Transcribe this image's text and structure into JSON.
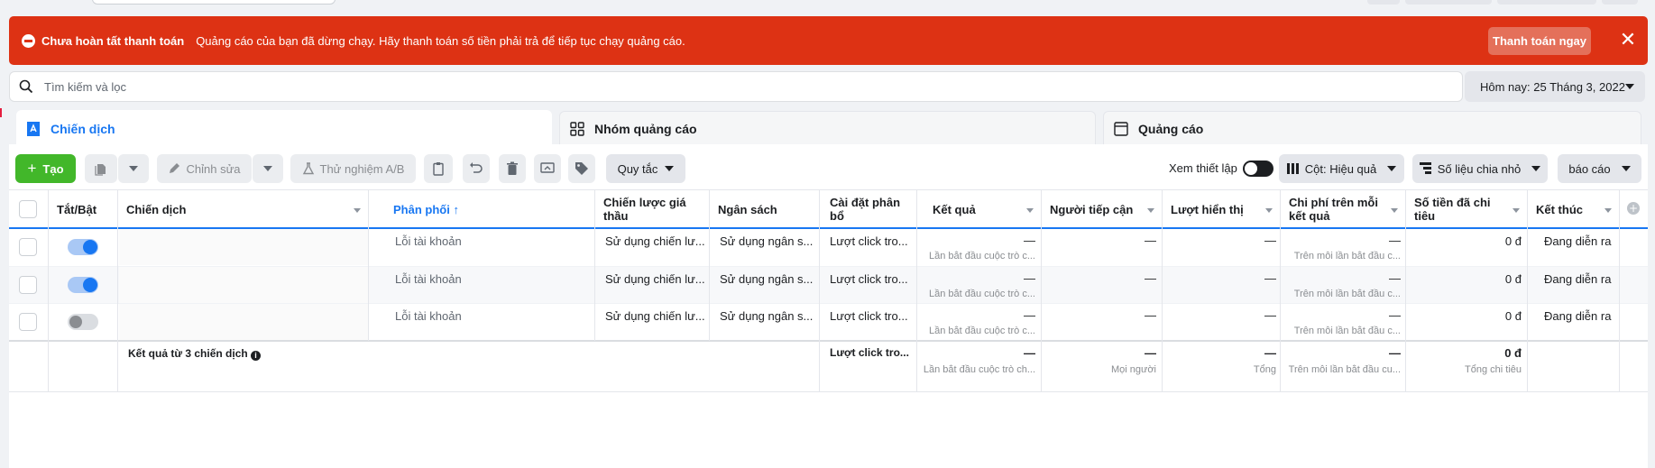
{
  "colors": {
    "alert_bg": "#dd3214",
    "accent": "#1877f2",
    "create_green": "#42b72a",
    "toggle_on": "#1877f2"
  },
  "alert": {
    "title": "Chưa hoàn tất thanh toán",
    "message": "Quảng cáo của bạn đã dừng chạy. Hãy thanh toán số tiền phải trả để tiếp tục chạy quảng cáo.",
    "cta": "Thanh toán ngay",
    "close": "✕"
  },
  "search": {
    "placeholder": "Tìm kiếm và lọc"
  },
  "date_range": "Hôm nay: 25 Tháng 3, 2022",
  "tabs": [
    {
      "label": "Chiến dịch",
      "icon": "campaign-icon"
    },
    {
      "label": "Nhóm quảng cáo",
      "icon": "ad-set-grid-icon"
    },
    {
      "label": "Quảng cáo",
      "icon": "ad-window-icon"
    }
  ],
  "toolbar": {
    "create": "Tạo",
    "edit": "Chỉnh sửa",
    "ab_test": "Thử nghiệm A/B",
    "rules": "Quy tắc",
    "view_setup": "Xem thiết lập",
    "columns": "Cột: Hiệu quả",
    "breakdown": "Số liệu chia nhỏ",
    "reports": "báo cáo"
  },
  "table": {
    "headers": {
      "toggle": "Tắt/Bật",
      "campaign": "Chiến dịch",
      "delivery": "Phân phối ↑",
      "bid_strategy": "Chiến lược giá thầu",
      "budget": "Ngân sách",
      "attribution": "Cài đặt phân bổ",
      "results": "Kết quả",
      "reach": "Người tiếp cận",
      "impressions": "Lượt hiển thị",
      "cost_per_result": "Chi phí trên mỗi kết quả",
      "amount_spent": "Số tiền đã chi tiêu",
      "ends": "Kết thúc"
    },
    "rows": [
      {
        "on": true,
        "delivery": "Lỗi tài khoản",
        "bid_strategy": "Sử dụng chiến lư...",
        "budget": "Sử dụng ngân s...",
        "attribution": "Lượt click tro...",
        "results": "—",
        "results_sub": "Lần bắt đầu cuộc trò c...",
        "reach": "—",
        "impressions": "—",
        "cost": "—",
        "cost_sub": "Trên mỗi lần bắt đầu c...",
        "spent": "0 đ",
        "ends": "Đang diễn ra"
      },
      {
        "on": true,
        "delivery": "Lỗi tài khoản",
        "bid_strategy": "Sử dụng chiến lư...",
        "budget": "Sử dụng ngân s...",
        "attribution": "Lượt click tro...",
        "results": "—",
        "results_sub": "Lần bắt đầu cuộc trò c...",
        "reach": "—",
        "impressions": "—",
        "cost": "—",
        "cost_sub": "Trên mỗi lần bắt đầu c...",
        "spent": "0 đ",
        "ends": "Đang diễn ra"
      },
      {
        "on": false,
        "delivery": "Lỗi tài khoản",
        "bid_strategy": "Sử dụng chiến lư...",
        "budget": "Sử dụng ngân s...",
        "attribution": "Lượt click tro...",
        "results": "—",
        "results_sub": "Lần bắt đầu cuộc trò c...",
        "reach": "—",
        "impressions": "—",
        "cost": "—",
        "cost_sub": "Trên mỗi lần bắt đầu c...",
        "spent": "0 đ",
        "ends": "Đang diễn ra"
      }
    ],
    "summary": {
      "label": "Kết quả từ 3 chiến dịch",
      "attribution": "Lượt click tro...",
      "results": "—",
      "results_sub": "Lần bắt đầu cuộc trò ch...",
      "reach": "—",
      "reach_sub": "Mọi người",
      "impressions": "—",
      "impressions_sub": "Tổng",
      "cost": "—",
      "cost_sub": "Trên mỗi lần bắt đầu cu...",
      "spent": "0 đ",
      "spent_sub": "Tổng chi tiêu"
    }
  }
}
